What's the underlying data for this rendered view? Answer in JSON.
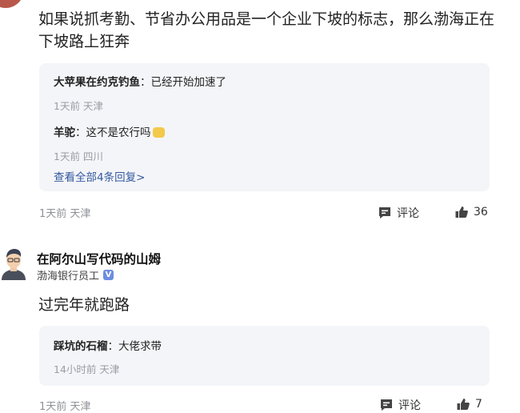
{
  "post1": {
    "text": "如果说抓考勤、节省办公用品是一个企业下坡的标志，那么渤海正在下坡路上狂奔",
    "replies": [
      {
        "user": "大苹果在约克钓鱼",
        "content": "已经开始加速了",
        "meta": "1天前 天津"
      },
      {
        "user": "羊驼",
        "content": "这不是农行吗",
        "meta": "1天前 四川"
      }
    ],
    "see_all": "查看全部4条回复>",
    "meta": "1天前 天津",
    "comment_label": "评论",
    "like_count": "36"
  },
  "post2": {
    "username": "在阿尔山写代码的山姆",
    "badge": "渤海银行员工",
    "text": "过完年就跑路",
    "replies": [
      {
        "user": "踩坑的石榴",
        "content": "大佬求带",
        "meta": "14小时前 天津"
      }
    ],
    "meta": "1天前 天津",
    "comment_label": "评论",
    "like_count": "7"
  },
  "colors": {
    "reply_bg": "#f4f5f9",
    "link": "#355a9f",
    "meta": "#9a9ca3",
    "badge": "#6d8ee0"
  },
  "icons": [
    "comment-icon",
    "thumbs-up-icon",
    "verified-icon",
    "smile-emoji"
  ]
}
